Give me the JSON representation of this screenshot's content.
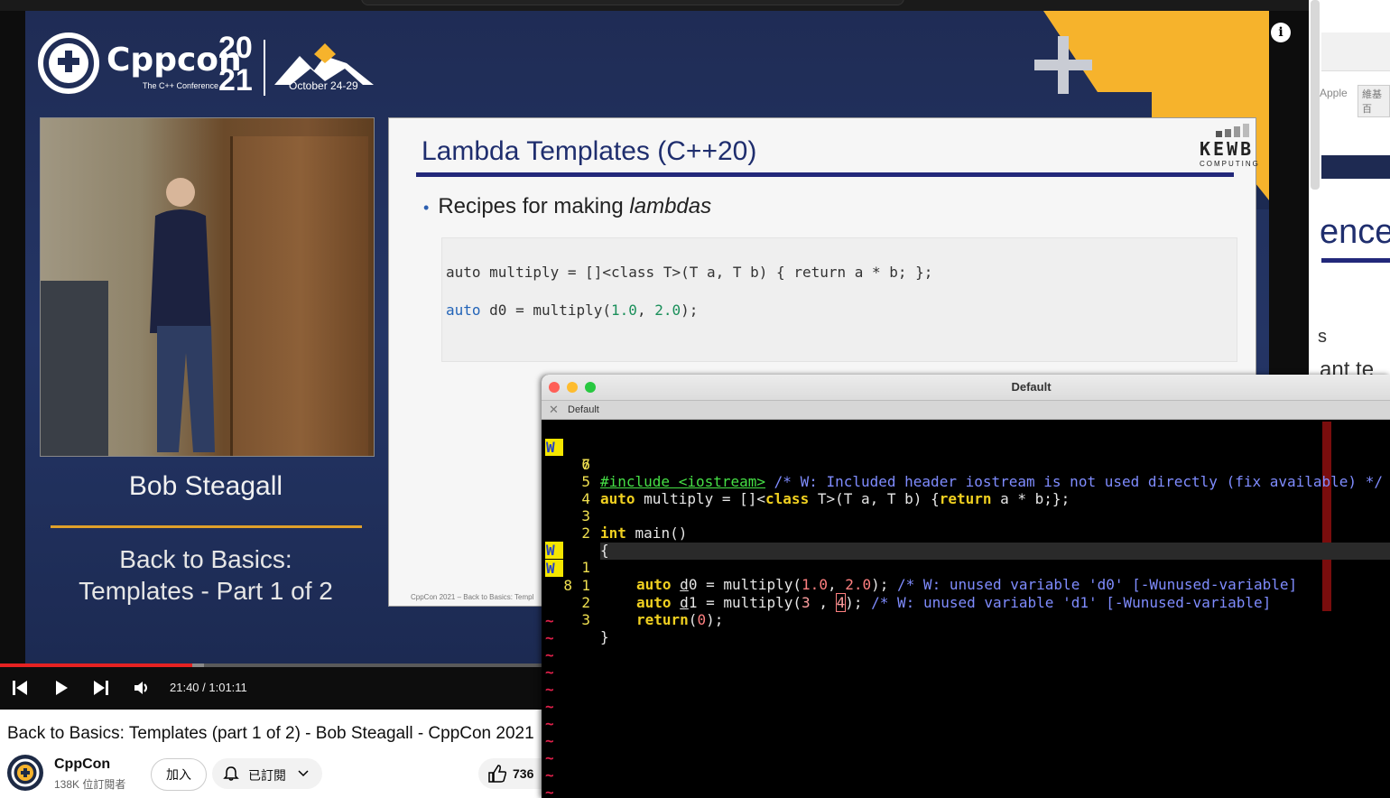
{
  "slide": {
    "conference_name": "Cppcon",
    "conference_tagline": "The C++ Conference",
    "year_top": "20",
    "year_bottom": "21",
    "dates": "October 24-29",
    "speaker": "Bob Steagall",
    "talk_title_line1": "Back to Basics:",
    "talk_title_line2": "Templates - Part 1 of 2",
    "card_title": "Lambda Templates (C++20)",
    "bullet": "Recipes for making ",
    "bullet_em": "lambdas",
    "code_line1": "auto multiply = []<class T>(T a, T b) { return a * b; };",
    "code_line2_kw": "auto",
    "code_line2_mid": " d0 = multiply(",
    "code_line2_n1": "1.0",
    "code_line2_sep": ", ",
    "code_line2_n2": "2.0",
    "code_line2_end": ");",
    "kewb_top": "KEWB",
    "kewb_bottom": "COMPUTING",
    "footer": "CppCon 2021 – Back to Basics: Templ"
  },
  "player": {
    "info_icon": "i",
    "time_text": "21:40 / 1:01:11",
    "played_fraction": 0.355,
    "buffered_fraction": 0.376,
    "icons": [
      "skip-previous-icon",
      "play-icon",
      "skip-next-icon",
      "volume-icon"
    ]
  },
  "video_info": {
    "title": "Back to Basics: Templates (part 1 of 2) - Bob Steagall - CppCon 2021",
    "channel_name": "CppCon",
    "subscribers": "138K 位訂閱者",
    "join_label": "加入",
    "subscribed_label": "已訂閱",
    "like_count": "736"
  },
  "right_panel": {
    "apple_label": "Apple",
    "tag_label": "維基百",
    "heading_fragment": "ence",
    "fragment1": "s",
    "fragment2": "ant te"
  },
  "terminal": {
    "window_title": "Default",
    "tab_label": "Default",
    "tab_close": "✕",
    "sign_warn": "W",
    "lines": [
      {
        "sign": "W",
        "num": "7"
      },
      {
        "sign": "",
        "num": "6"
      },
      {
        "sign": "",
        "num": "5"
      },
      {
        "sign": "",
        "num": "4"
      },
      {
        "sign": "",
        "num": "3"
      },
      {
        "sign": "",
        "num": "2"
      },
      {
        "sign": "W",
        "num": "1"
      },
      {
        "sign": "W",
        "num": "8"
      },
      {
        "sign": "",
        "num": "1"
      },
      {
        "sign": "",
        "num": "2"
      },
      {
        "sign": "",
        "num": "3"
      }
    ],
    "code": {
      "l1_inc": "#include <iostream>",
      "l1_cmt": " /* W: Included header iostream is not used directly (fix available) */",
      "l3_kw1": "auto",
      "l3_a": " multiply = []<",
      "l3_kw2": "class",
      "l3_b": " T>(T a, T b) {",
      "l3_kw3": "return",
      "l3_c": " a * b;};",
      "l5_kw": "int",
      "l5_a": " main()",
      "l6": "{",
      "l7_kw": "auto",
      "l7_d": "d",
      "l7_a": "0 = multiply(",
      "l7_n1": "1.0",
      "l7_sep": ", ",
      "l7_n2": "2.0",
      "l7_b": "); ",
      "l7_cmt": "/* W: unused variable 'd0' [-Wunused-variable]",
      "l8_kw": "auto",
      "l8_d": "d",
      "l8_a": "1 = multiply(",
      "l8_n1": "3",
      "l8_sep": " , ",
      "l8_n2": "4",
      "l8_b": "); ",
      "l8_cmt": "/* W: unused variable 'd1' [-Wunused-variable]",
      "l10_kw": "return",
      "l10_a": "(",
      "l10_n": "0",
      "l10_b": ");",
      "l11": "}"
    },
    "tilde": "~"
  },
  "colors": {
    "slide_bg": "#243565",
    "accent_orange": "#f6b32c",
    "progress_red": "#e52222",
    "term_keyword": "#f0d020",
    "term_comment": "#7f8cff",
    "term_warning_sign": "#f5e600"
  }
}
